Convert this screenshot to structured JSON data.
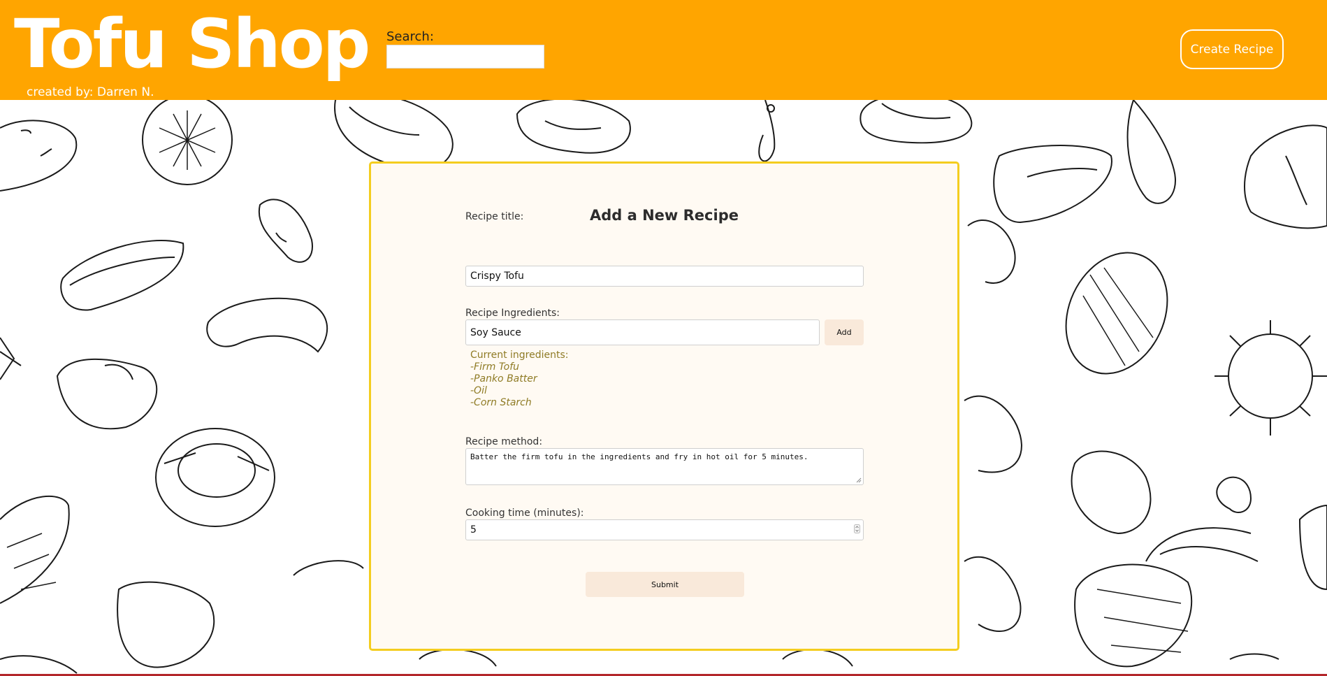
{
  "header": {
    "brand": "Tofu Shop",
    "credit": "created by: Darren N.",
    "search_label": "Search:",
    "search_value": "",
    "create_button": "Create Recipe"
  },
  "form": {
    "title": "Add a New Recipe",
    "recipe_title_label": "Recipe title:",
    "recipe_title_value": "Crispy Tofu",
    "ingredients_label": "Recipe Ingredients:",
    "ingredient_input_value": "Soy Sauce",
    "add_button": "Add",
    "current_ingredients_label": "Current ingredients:",
    "current_ingredients": [
      "-Firm Tofu",
      "-Panko Batter",
      "-Oil",
      "-Corn Starch"
    ],
    "method_label": "Recipe method:",
    "method_value": "Batter the firm tofu in the ingredients and fry in hot oil for 5 minutes.",
    "cooking_time_label": "Cooking time (minutes):",
    "cooking_time_value": "5",
    "submit_button": "Submit"
  },
  "colors": {
    "header_bg": "#ffa500",
    "card_border": "#f4cd1f",
    "card_bg": "#fffaf3",
    "ingredient_text": "#8f7b25",
    "button_bg": "#f9e9da"
  }
}
